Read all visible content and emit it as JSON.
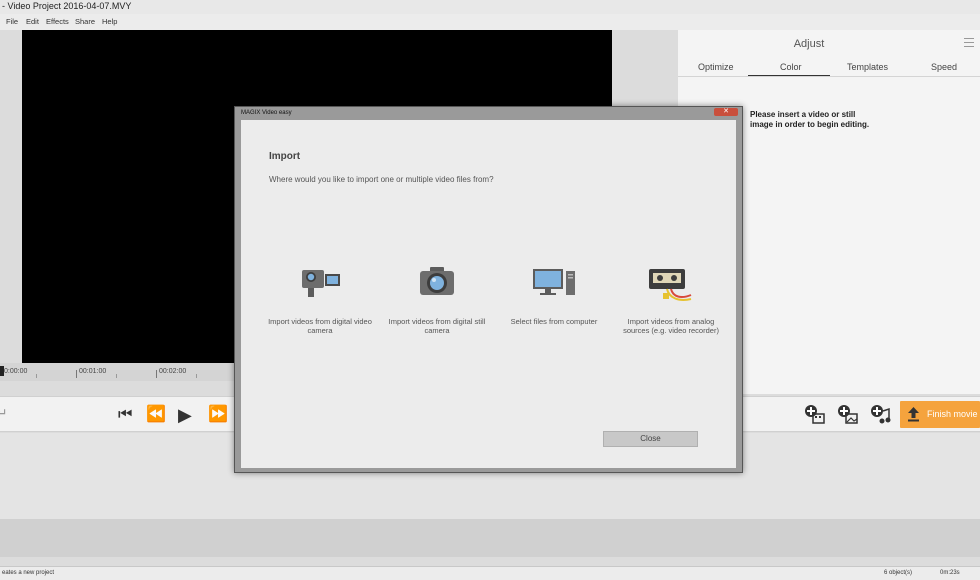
{
  "window": {
    "title": "- Video Project 2016-04-07.MVY"
  },
  "menu": [
    "File",
    "Edit",
    "Effects",
    "Share",
    "Help"
  ],
  "timeline_ruler": [
    "0:00:00",
    "00:01:00",
    "00:02:00"
  ],
  "adjust_panel": {
    "title": "Adjust",
    "tabs": [
      "Optimize",
      "Color",
      "Templates",
      "Speed"
    ],
    "active_tab": "Color",
    "info": "Please insert a video or still image in order to begin editing."
  },
  "toolbar": {
    "finish_label": "Finish movie"
  },
  "dialog": {
    "title": "MAGIX Video easy",
    "heading": "Import",
    "question": "Where would you like to import one or multiple video files from?",
    "options": [
      {
        "icon": "video-camera-icon",
        "label": "Import videos from digital video camera"
      },
      {
        "icon": "photo-camera-icon",
        "label": "Import videos from digital still camera"
      },
      {
        "icon": "computer-icon",
        "label": "Select files from computer"
      },
      {
        "icon": "vhs-tape-icon",
        "label": "Import videos from analog sources (e.g. video recorder)"
      }
    ],
    "close_label": "Close"
  },
  "status": {
    "left": "eates a new project",
    "objects": "6 object(s)",
    "duration": "0m:23s"
  },
  "colors": {
    "accent": "#f5a33d",
    "close_red": "#c94f3c"
  }
}
